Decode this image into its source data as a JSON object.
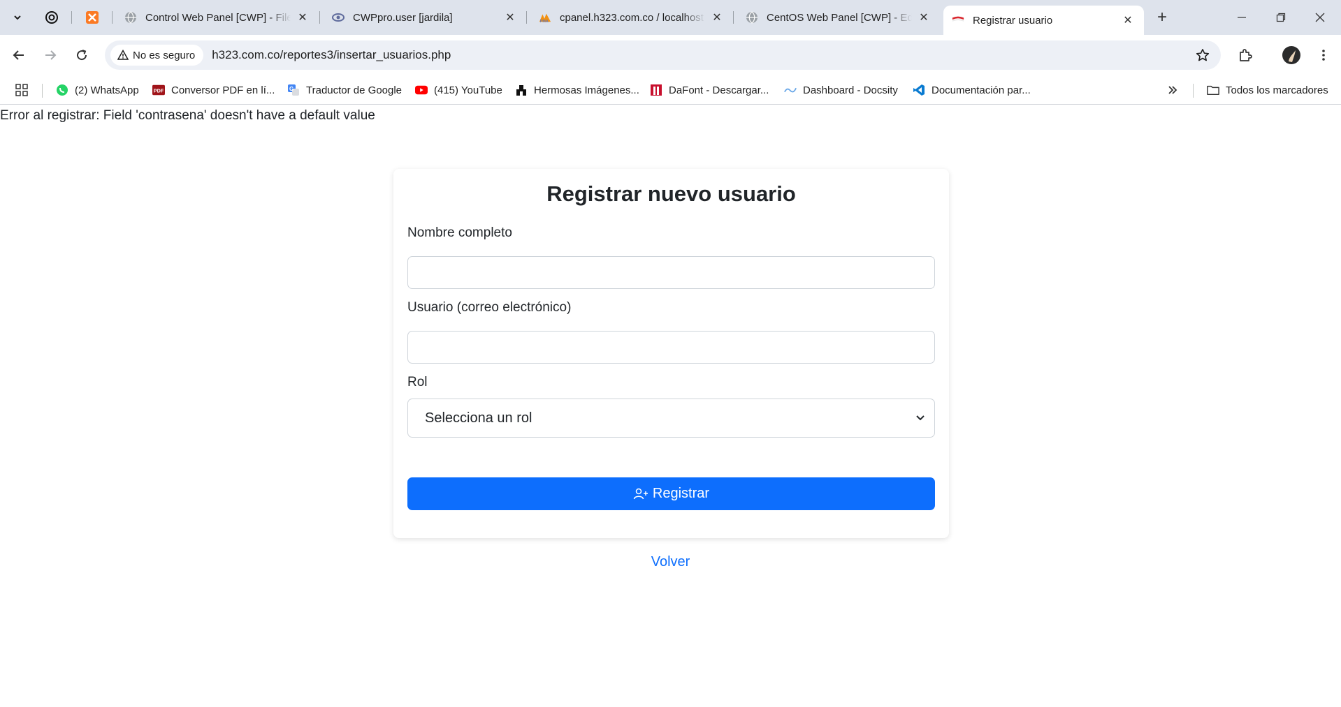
{
  "browser": {
    "tabs": [
      {
        "title": "Control Web Panel [CWP] - File",
        "favicon": "globe-icon"
      },
      {
        "title": "CWPpro.user [jardila]",
        "favicon": "cwp-icon"
      },
      {
        "title": "cpanel.h323.com.co / localhost",
        "favicon": "phpmyadmin-icon"
      },
      {
        "title": "CentOS Web Panel [CWP] - Edit",
        "favicon": "globe-icon"
      },
      {
        "title": "Registrar usuario",
        "favicon": "flag-icon"
      }
    ],
    "address": {
      "security_label": "No es seguro",
      "url": "h323.com.co/reportes3/insertar_usuarios.php"
    },
    "bookmarks": [
      {
        "label": "(2) WhatsApp",
        "icon": "whatsapp-icon"
      },
      {
        "label": "Conversor PDF en lí...",
        "icon": "pdf-icon"
      },
      {
        "label": "Traductor de Google",
        "icon": "translate-icon"
      },
      {
        "label": "(415) YouTube",
        "icon": "youtube-icon"
      },
      {
        "label": "Hermosas Imágenes...",
        "icon": "image-icon"
      },
      {
        "label": "DaFont - Descargar...",
        "icon": "dafont-icon"
      },
      {
        "label": "Dashboard - Docsity",
        "icon": "docsity-icon"
      },
      {
        "label": "Documentación par...",
        "icon": "vscode-icon"
      }
    ],
    "all_bookmarks": "Todos los marcadores"
  },
  "page": {
    "error": "Error al registrar: Field 'contrasena' doesn't have a default value",
    "form": {
      "title": "Registrar nuevo usuario",
      "name_label": "Nombre completo",
      "name_value": "",
      "email_label": "Usuario (correo electrónico)",
      "email_value": "",
      "role_label": "Rol",
      "role_selected": "Selecciona un rol",
      "submit_label": "Registrar"
    },
    "back_link": "Volver"
  },
  "colors": {
    "primary": "#0d6efd",
    "tabstrip": "#dee3ec",
    "omnibox": "#edf0f6"
  }
}
